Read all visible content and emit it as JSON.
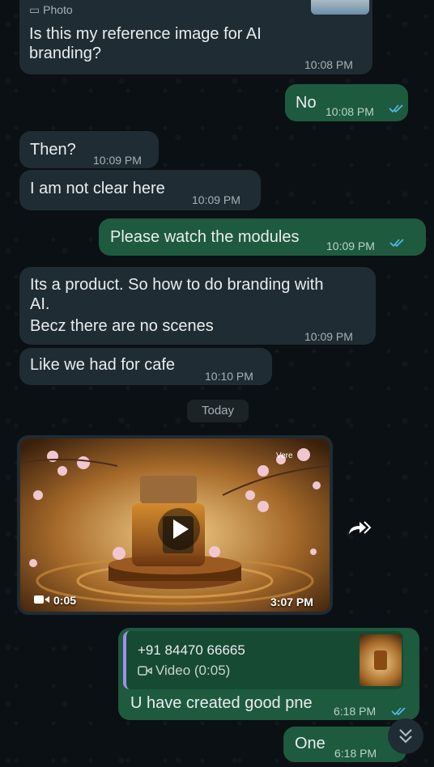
{
  "top_cut": {
    "label": "Photo"
  },
  "messages": [
    {
      "id": "m1",
      "dir": "in",
      "text_line1": "Is this my reference image for AI",
      "text_line2": "branding?",
      "time": "10:08 PM"
    },
    {
      "id": "m2",
      "dir": "out",
      "text": "No",
      "time": "10:08 PM"
    },
    {
      "id": "m3",
      "dir": "in",
      "text": "Then?",
      "time": "10:09 PM"
    },
    {
      "id": "m4",
      "dir": "in",
      "text": "I am not clear here",
      "time": "10:09 PM"
    },
    {
      "id": "m5",
      "dir": "out",
      "text": "Please watch the modules",
      "time": "10:09 PM"
    },
    {
      "id": "m6",
      "dir": "in",
      "text_line1": "Its a product. So how to do branding with",
      "text_line2": "AI.",
      "text_line3": "Becz there are no scenes",
      "time": "10:09 PM"
    },
    {
      "id": "m7",
      "dir": "in",
      "text": "Like we had for cafe",
      "time": "10:10 PM"
    }
  ],
  "date_separator": "Today",
  "video_message": {
    "duration": "0:05",
    "time": "3:07 PM",
    "watermark": "Vere"
  },
  "reply_message": {
    "quoted_sender": "+91 84470 66665",
    "quoted_type": "Video (0:05)",
    "text": "U have created good pne",
    "time": "6:18 PM"
  },
  "last_message": {
    "text": "One",
    "time": "6:18 PM"
  },
  "colors": {
    "incoming": "#202c33",
    "outgoing": "#1e5a3e",
    "read_ticks": "#53bdeb"
  }
}
